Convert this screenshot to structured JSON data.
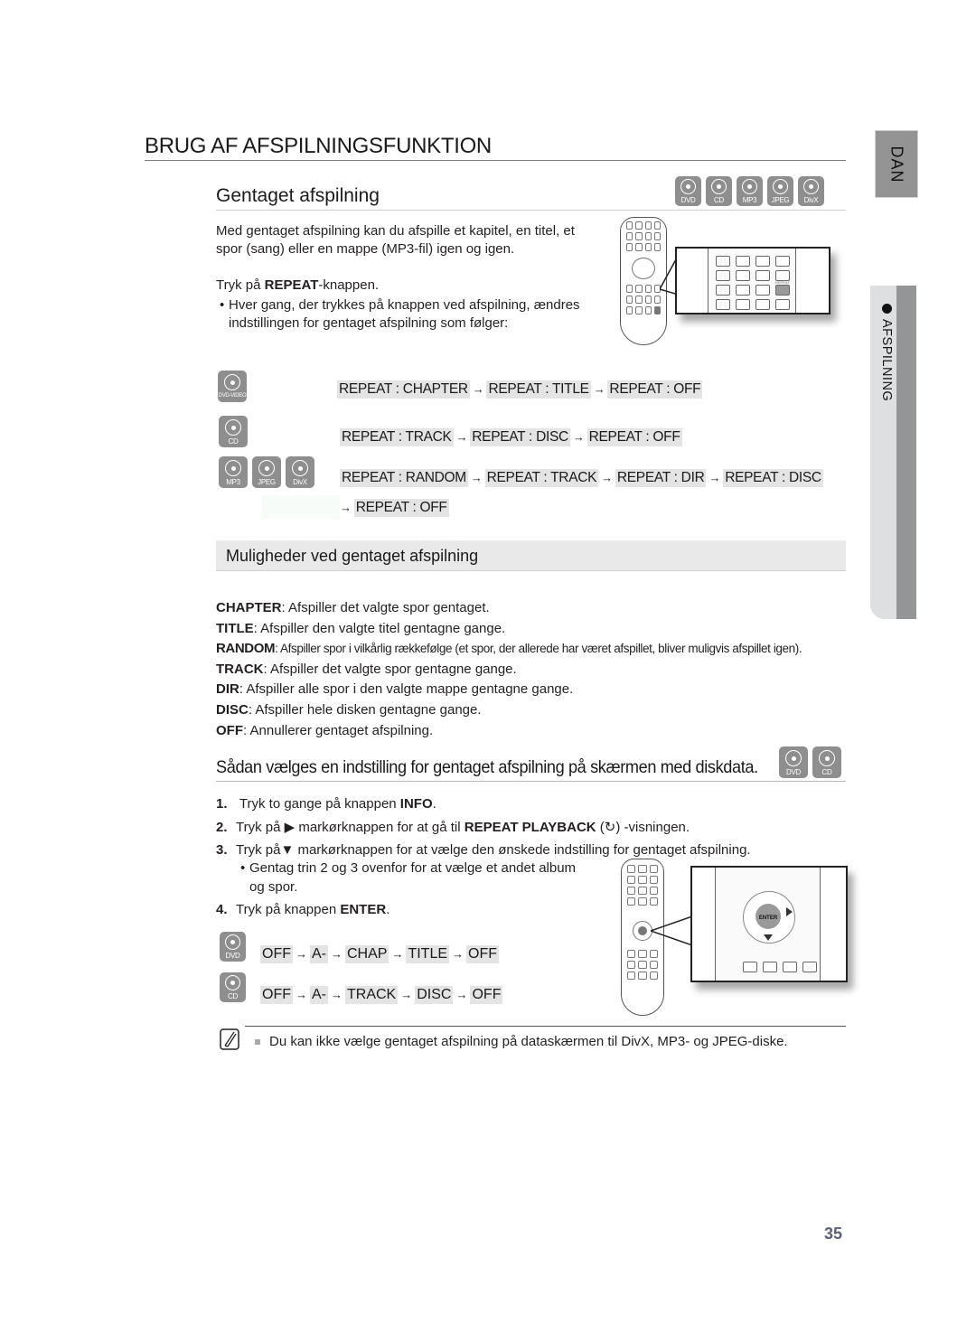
{
  "page": {
    "title": "BRUG AF AFSPILNINGSFUNKTION",
    "number": "35"
  },
  "side_tabs": {
    "language": "DAN",
    "section": "AFSPILNING"
  },
  "section_repeat": {
    "heading": "Gentaget afspilning",
    "disc_icons": [
      "DVD",
      "CD",
      "MP3",
      "JPEG",
      "DivX"
    ],
    "intro_line1": "Med gentaget afspilning kan du afspille et kapitel, en titel, et",
    "intro_line2": "spor (sang) eller en mappe (MP3-fil) igen og igen.",
    "press_prefix": "Tryk på ",
    "press_key": "REPEAT",
    "press_suffix": "-knappen.",
    "bullet_line1": "Hver gang, der trykkes på knappen ved afspilning, ændres",
    "bullet_line2": "indstillingen for gentaget afspilning som følger:",
    "remote_highlight_button": "REPEAT",
    "flows": [
      {
        "discs": [
          "DVD-VIDEO"
        ],
        "steps": [
          "REPEAT : CHAPTER",
          "REPEAT : TITLE",
          "REPEAT : OFF"
        ]
      },
      {
        "discs": [
          "CD"
        ],
        "steps": [
          "REPEAT : TRACK",
          "REPEAT : DISC",
          "REPEAT : OFF"
        ]
      },
      {
        "discs": [
          "MP3",
          "JPEG",
          "DivX"
        ],
        "steps": [
          "REPEAT : RANDOM",
          "REPEAT : TRACK",
          "REPEAT : DIR",
          "REPEAT : DISC"
        ],
        "continuation": [
          "REPEAT : OFF"
        ]
      }
    ],
    "arrow": "→"
  },
  "section_options": {
    "heading": "Muligheder ved gentaget afspilning",
    "definitions": [
      {
        "term": "CHAPTER",
        "text": ": Afspiller det valgte spor gentaget."
      },
      {
        "term": "TITLE",
        "text": ": Afspiller den valgte titel gentagne gange."
      },
      {
        "term": "RANDOM",
        "text": ": Afspiller spor i vilkårlig rækkefølge (et spor, der allerede har været afspillet, bliver muligvis afspillet igen)."
      },
      {
        "term": "TRACK",
        "text": ": Afspiller det valgte spor gentagne gange."
      },
      {
        "term": "DIR",
        "text": ": Afspiller alle spor i den valgte mappe gentagne gange."
      },
      {
        "term": "DISC",
        "text": ": Afspiller hele disken gentagne gange."
      },
      {
        "term": "OFF",
        "text": ": Annullerer gentaget afspilning."
      }
    ]
  },
  "section_howto": {
    "heading": "Sådan vælges en indstilling for gentaget afspilning på skærmen med diskdata.",
    "disc_icons": [
      "DVD",
      "CD"
    ],
    "steps": [
      {
        "num": "1.",
        "pre": " Tryk to gange på knappen ",
        "key": "INFO",
        "post": "."
      },
      {
        "num": "2.",
        "pre": "Tryk på ▶ markørknappen for at gå til ",
        "key": "REPEAT PLAYBACK",
        "post": " (↻) -visningen."
      },
      {
        "num": "3.",
        "pre": "Tryk på▼ markørknappen  for at vælge den ønskede indstilling for gentaget afspilning.",
        "key": "",
        "post": ""
      }
    ],
    "sub_bullet_line1": "Gentag trin 2 og 3 ovenfor for at vælge et andet album",
    "sub_bullet_line2": "og spor.",
    "step4": {
      "num": "4.",
      "pre": "Tryk på knappen ",
      "key": "ENTER",
      "post": "."
    },
    "remote_center_label": "ENTER",
    "flows": [
      {
        "disc": "DVD",
        "steps": [
          "OFF",
          "A-",
          "CHAP",
          "TITLE",
          "OFF"
        ]
      },
      {
        "disc": "CD",
        "steps": [
          "OFF",
          "A-",
          "TRACK",
          "DISC",
          "OFF"
        ]
      }
    ]
  },
  "note": {
    "text": "Du kan ikke vælge gentaget afspilning på dataskærmen til DivX, MP3- og JPEG-diske."
  }
}
